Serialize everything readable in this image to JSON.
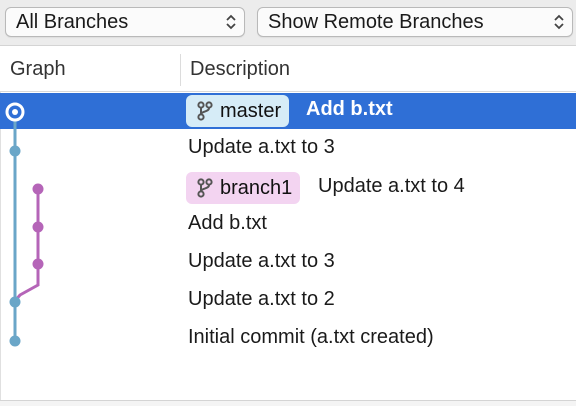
{
  "toolbar": {
    "branches_filter": "All Branches",
    "remote_filter": "Show Remote Branches"
  },
  "columns": {
    "graph": "Graph",
    "description": "Description"
  },
  "commits": [
    {
      "badge": "master",
      "message": "Add b.txt",
      "selected": true
    },
    {
      "message": "Update a.txt to 3"
    },
    {
      "badge": "branch1",
      "message": "Update a.txt to 4"
    },
    {
      "message": "Add b.txt"
    },
    {
      "message": "Update a.txt to 3"
    },
    {
      "message": "Update a.txt to 2"
    },
    {
      "message": "Initial commit (a.txt created)"
    }
  ],
  "colors": {
    "selection": "#2f6fd6",
    "master_lane": "#6aa6c8",
    "branch1_lane": "#b565b8",
    "master_badge": "#d6ecf7",
    "branch1_badge": "#f3d4f1"
  },
  "icons": {
    "branch": "branch-icon",
    "popup_arrows": "up-down-chevron-icon"
  }
}
